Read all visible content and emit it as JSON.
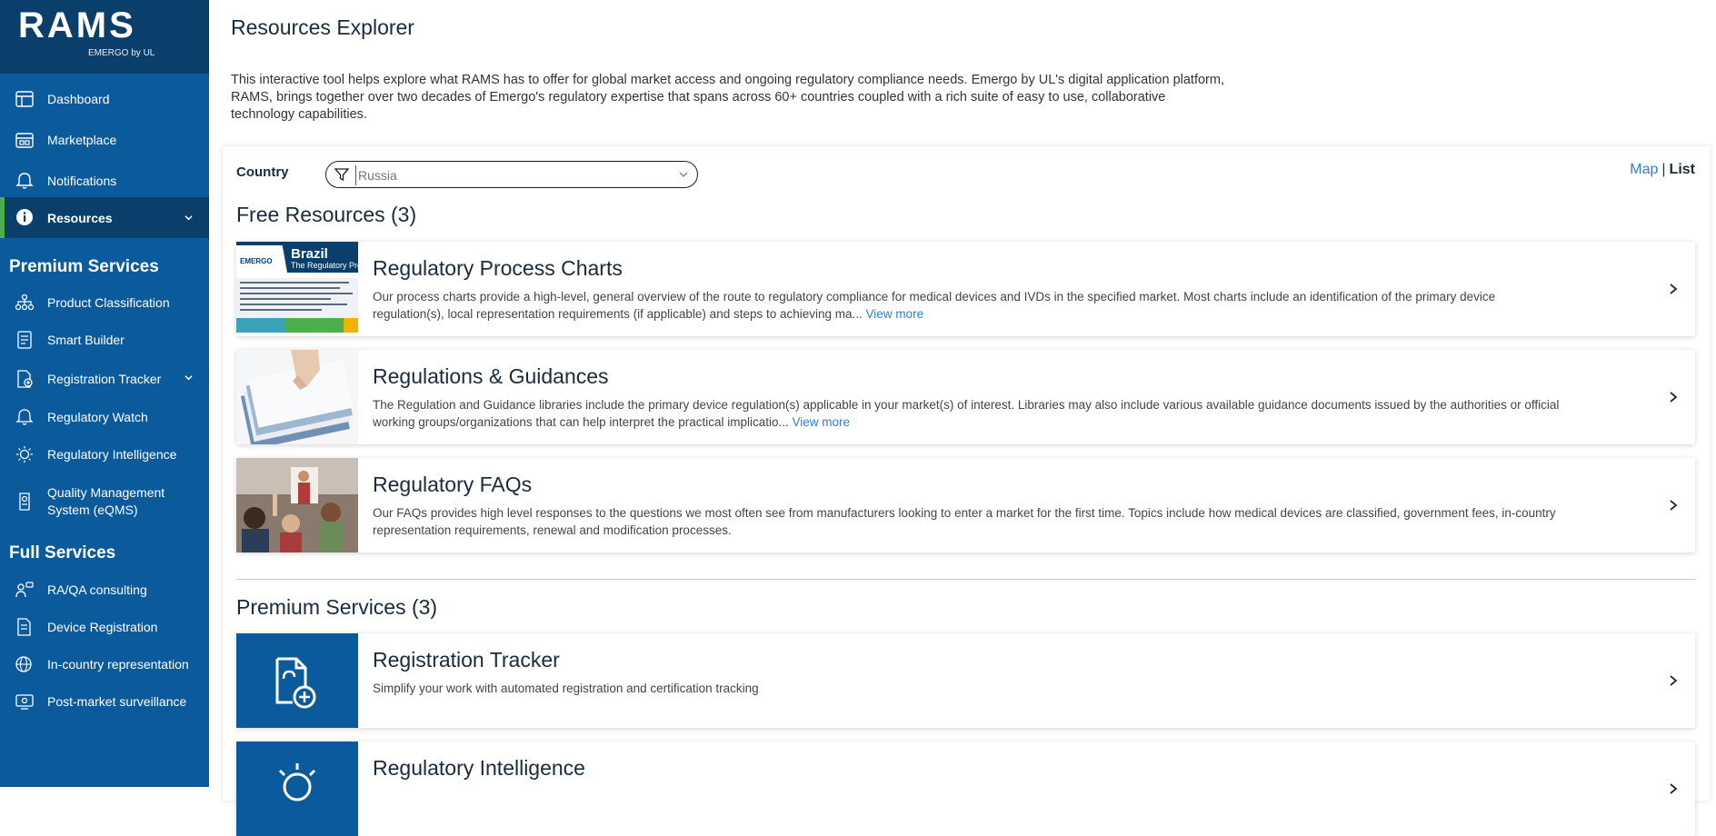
{
  "logo": {
    "brand": "RAMS",
    "sub": "EMERGO by UL"
  },
  "sidebar": {
    "top_items": [
      {
        "label": "Dashboard",
        "icon": "dashboard-icon"
      },
      {
        "label": "Marketplace",
        "icon": "marketplace-icon"
      },
      {
        "label": "Notifications",
        "icon": "bell-icon"
      },
      {
        "label": "Resources",
        "icon": "info-icon"
      }
    ],
    "premium_heading": "Premium Services",
    "premium_items": [
      {
        "label": "Product Classification",
        "icon": "classification-icon"
      },
      {
        "label": "Smart Builder",
        "icon": "builder-icon"
      },
      {
        "label": "Registration Tracker",
        "icon": "tracker-icon"
      },
      {
        "label": "Regulatory Watch",
        "icon": "watch-icon"
      },
      {
        "label": "Regulatory Intelligence",
        "icon": "intelligence-icon"
      },
      {
        "label": "Quality Management",
        "label2": "System (eQMS)",
        "icon": "qms-icon"
      }
    ],
    "full_heading": "Full Services",
    "full_items": [
      {
        "label": "RA/QA consulting",
        "icon": "consulting-icon"
      },
      {
        "label": "Device Registration",
        "icon": "registration-icon"
      },
      {
        "label": "In-country representation",
        "icon": "globe-icon"
      },
      {
        "label": "Post-market surveillance",
        "icon": "surveillance-icon"
      }
    ]
  },
  "main": {
    "title": "Resources Explorer",
    "intro_line1": "This interactive tool helps explore what RAMS has to offer for global market access and ongoing regulatory compliance needs. Emergo by UL's digital application platform,",
    "intro_line2": "RAMS, brings together over two decades of Emergo's regulatory expertise that spans across 60+ countries coupled with a rich suite of easy to use, collaborative",
    "intro_line3": "technology capabilities.",
    "country_label": "Country",
    "country_placeholder": "Russia",
    "view_map": "Map",
    "view_sep": "|",
    "view_list": "List",
    "free_title": "Free Resources (3)",
    "free_resources": [
      {
        "title": "Regulatory Process Charts",
        "desc": "Our process charts provide a high-level, general overview of the route to regulatory compliance for medical devices and IVDs in the specified market. Most charts include an identification of the primary device regulation(s), local representation requirements (if applicable) and steps to achieving ma...",
        "more": "View more",
        "thumb_logo": "EMERGO",
        "thumb_country": "Brazil",
        "thumb_sub": "The Regulatory Pro"
      },
      {
        "title": "Regulations & Guidances",
        "desc": "The Regulation and Guidance libraries include the primary device regulation(s) applicable in your market(s) of interest. Libraries may also include various available guidance documents issued by the authorities or official working groups/organizations that can help interpret the practical implicatio...",
        "more": "View more"
      },
      {
        "title": "Regulatory FAQs",
        "desc": "Our FAQs provides high level responses to the questions we most often see from manufacturers looking to enter a market for the first time. Topics include how medical devices are classified, government fees, in-country representation requirements, renewal and modification processes."
      }
    ],
    "premium_title": "Premium Services (3)",
    "premium_services": [
      {
        "title": "Registration Tracker",
        "desc": "Simplify your work with automated registration and certification tracking"
      },
      {
        "title": "Regulatory Intelligence",
        "desc": ""
      }
    ]
  },
  "colors": {
    "sidebar": "#0a5a9c",
    "sidebar_dark": "#0b3f6b",
    "accent_green": "#4cae4c",
    "link": "#2a7fd4"
  }
}
